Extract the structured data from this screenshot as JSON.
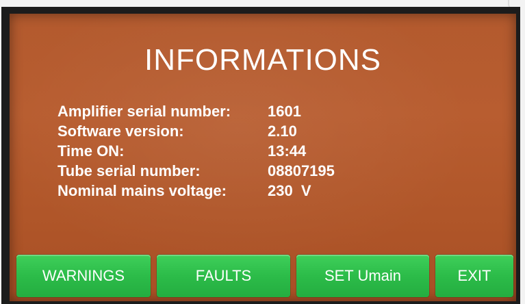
{
  "screen": {
    "title": "INFORMATIONS",
    "background_color": "#b35a2e",
    "text_color": "#ffffff"
  },
  "info": {
    "rows": [
      {
        "label": "Amplifier serial number:",
        "value": "1601"
      },
      {
        "label": "Software version:",
        "value": "2.10"
      },
      {
        "label": "Time ON:",
        "value": "13:44"
      },
      {
        "label": "Tube serial number:",
        "value": "08807195"
      },
      {
        "label": "Nominal mains voltage:",
        "value": "230  V"
      }
    ]
  },
  "buttons": {
    "warnings": "WARNINGS",
    "faults": "FAULTS",
    "set_umain": "SET Umain",
    "exit": "EXIT",
    "color": "#2cbc49"
  }
}
